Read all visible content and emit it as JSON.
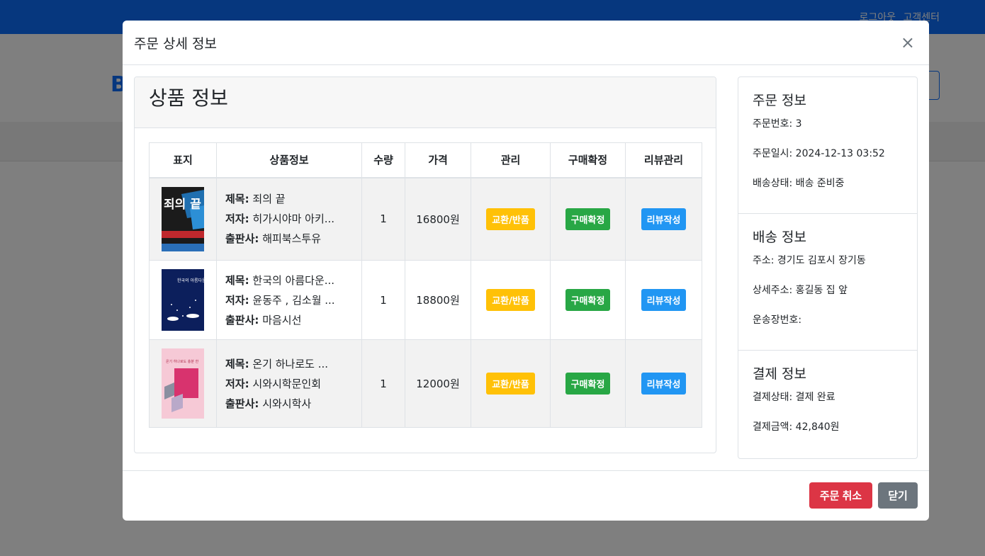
{
  "background": {
    "topbar_links": [
      "로그아웃",
      "고객센터"
    ],
    "logo_text": "B"
  },
  "colors": {
    "primary": "#0d6efd",
    "danger": "#dc3545",
    "secondary": "#6c757d",
    "warning": "#ffc107",
    "success": "#28a745",
    "info": "#2196f3"
  },
  "modal": {
    "title": "주문 상세 정보",
    "close_icon": "close-icon",
    "close_glyph": "×"
  },
  "products": {
    "title": "상품 정보",
    "columns": [
      "표지",
      "상품정보",
      "수량",
      "가격",
      "관리",
      "구매확정",
      "리뷰관리"
    ],
    "labels": {
      "title": "제목:",
      "author": "저자:",
      "publisher": "출판사:"
    },
    "rows": [
      {
        "title": "죄의 끝",
        "author": "히가시야마 아키...",
        "publisher": "해피북스투유",
        "quantity": "1",
        "price": "16800원",
        "exchange_label": "교환/반품",
        "confirm_label": "구매확정",
        "review_label": "리뷰작성",
        "cover_text": "죄의 끝"
      },
      {
        "title": "한국의 아름다운...",
        "author": "윤동주 , 김소월 ...",
        "publisher": "마음시선",
        "quantity": "1",
        "price": "18800원",
        "exchange_label": "교환/반품",
        "confirm_label": "구매확정",
        "review_label": "리뷰작성",
        "cover_text": "한국의 아름다운 시"
      },
      {
        "title": "온기 하나로도 ...",
        "author": "시와시학문인회",
        "publisher": "시와시학사",
        "quantity": "1",
        "price": "12000원",
        "exchange_label": "교환/반품",
        "confirm_label": "구매확정",
        "review_label": "리뷰작성",
        "cover_text": "온기 하나로도 충분 한"
      }
    ]
  },
  "order_info": {
    "title": "주문 정보",
    "order_number": "주문번호: 3",
    "order_date": "주문일시: 2024-12-13 03:52",
    "delivery_status": "배송상태: 배송 준비중"
  },
  "shipping_info": {
    "title": "배송 정보",
    "address": "주소: 경기도 김포시 장기동",
    "detail_address": "상세주소: 홍길동 집 앞",
    "tracking_number": "운송장번호:"
  },
  "payment_info": {
    "title": "결제 정보",
    "status": "결제상태: 결제 완료",
    "amount": "결제금액: 42,840원"
  },
  "footer": {
    "cancel_label": "주문 취소",
    "close_label": "닫기"
  }
}
